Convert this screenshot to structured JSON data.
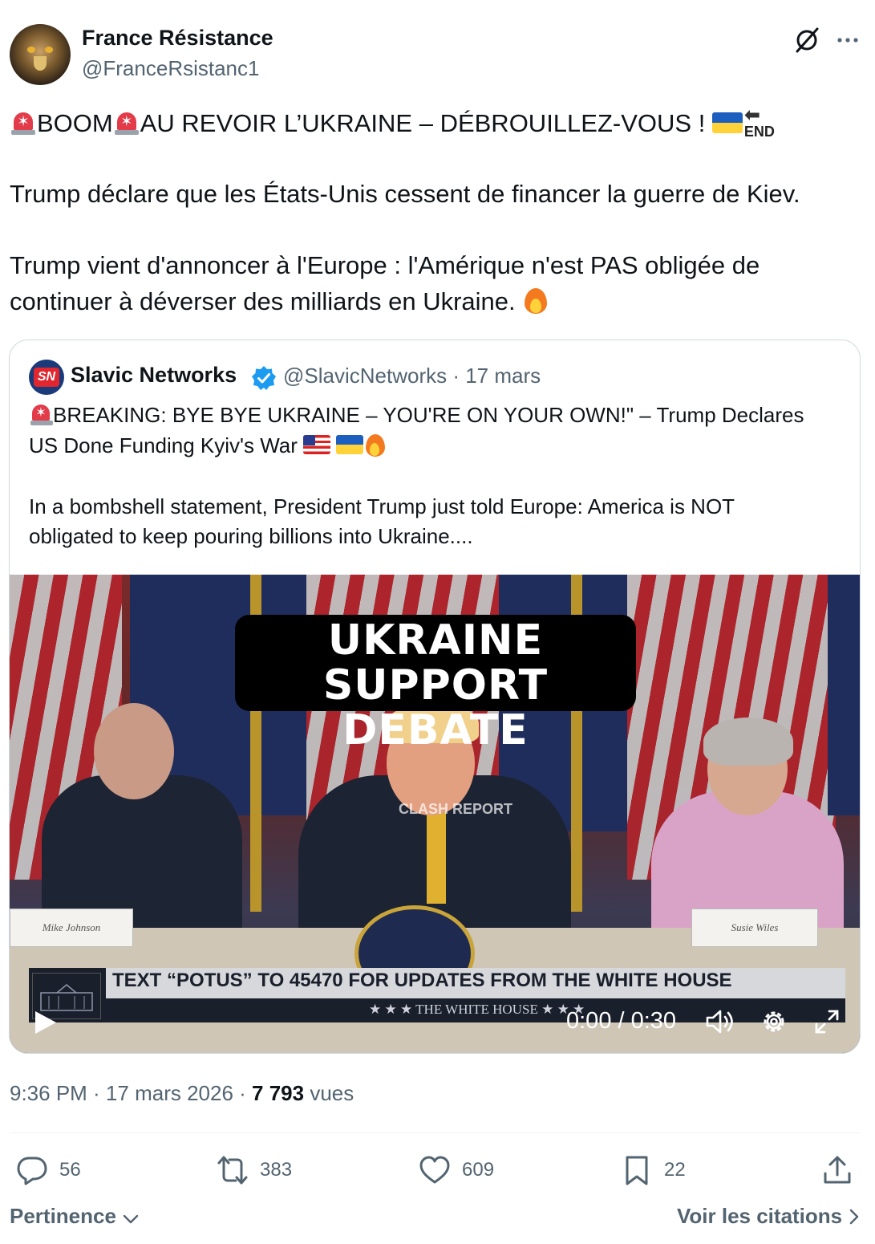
{
  "author": {
    "display_name": "France Résistance",
    "handle": "@FranceRsistanc1"
  },
  "tweet": {
    "line1_a": "BOOM",
    "line1_b": "AU REVOIR L’UKRAINE – DÉBROUILLEZ-VOUS ! ",
    "end_label": "END",
    "line2": "Trump déclare que les États-Unis cessent de financer la guerre de Kiev.",
    "line3": "Trump vient d'annoncer à l'Europe : l'Amérique n'est PAS obligée de",
    "line4": "continuer à déverser des milliards en Ukraine. "
  },
  "quote": {
    "name": "Slavic Networks",
    "handle_date": "@SlavicNetworks · 17 mars",
    "line1": "BREAKING: BYE BYE UKRAINE – YOU'RE ON YOUR OWN!\" – Trump Declares",
    "line2": "US Done Funding Kyiv's War ",
    "line3": "In a bombshell statement, President Trump just told Europe: America is NOT",
    "line4": "obligated to keep pouring billions into Ukraine....",
    "video": {
      "title_line1": "UKRAINE SUPPORT",
      "title_line2": "DEBATE",
      "ticker": "TEXT “POTUS” TO 45470 FOR UPDATES FROM THE WHITE HOUSE",
      "ticker_sub": "★ ★ ★   THE WHITE HOUSE   ★ ★ ★",
      "watermark": "CLASH REPORT",
      "nameplate_left": "Mike Johnson",
      "nameplate_right": "Susie Wiles",
      "time": "0:00 / 0:30"
    }
  },
  "meta": {
    "time_date": "9:36 PM · 17 mars 2026 · ",
    "views_count": "7 793",
    "views_label": " vues"
  },
  "actions": {
    "replies": "56",
    "reposts": "383",
    "likes": "609",
    "bookmarks": "22"
  },
  "footer": {
    "sort_label": "Pertinence",
    "quotes_link": "Voir les citations"
  },
  "colors": {
    "text": "#0f1419",
    "secondary": "#536471",
    "verified": "#1d9bf0",
    "border": "#cfd9de"
  }
}
